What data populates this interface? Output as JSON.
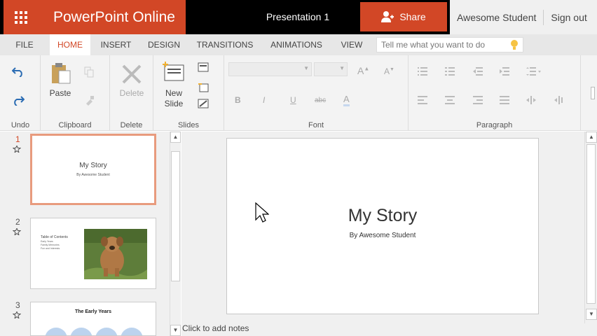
{
  "app": {
    "brand": "PowerPoint Online",
    "doc_title": "Presentation 1",
    "share_label": "Share",
    "user_name": "Awesome Student",
    "signout_label": "Sign out"
  },
  "tabs": [
    "FILE",
    "HOME",
    "INSERT",
    "DESIGN",
    "TRANSITIONS",
    "ANIMATIONS",
    "VIEW"
  ],
  "active_tab": "HOME",
  "tellme_placeholder": "Tell me what you want to do",
  "ribbon": {
    "undo_group": "Undo",
    "clipboard_group": "Clipboard",
    "paste": "Paste",
    "delete_group": "Delete",
    "delete": "Delete",
    "slides_group": "Slides",
    "new_slide_line1": "New",
    "new_slide_line2": "Slide",
    "font_group": "Font",
    "paragraph_group": "Paragraph"
  },
  "slides": [
    {
      "num": "1",
      "title": "My Story",
      "subtitle": "By Awesome Student"
    },
    {
      "num": "2",
      "title": "Table of Contents",
      "lines": [
        "Early Years",
        "Family Memories",
        "Fun and Interests"
      ]
    },
    {
      "num": "3",
      "title": "The Early Years"
    }
  ],
  "current_slide": {
    "title": "My Story",
    "subtitle": "By Awesome Student"
  },
  "notes_placeholder": "Click to add notes",
  "colors": {
    "accent": "#d24726"
  }
}
